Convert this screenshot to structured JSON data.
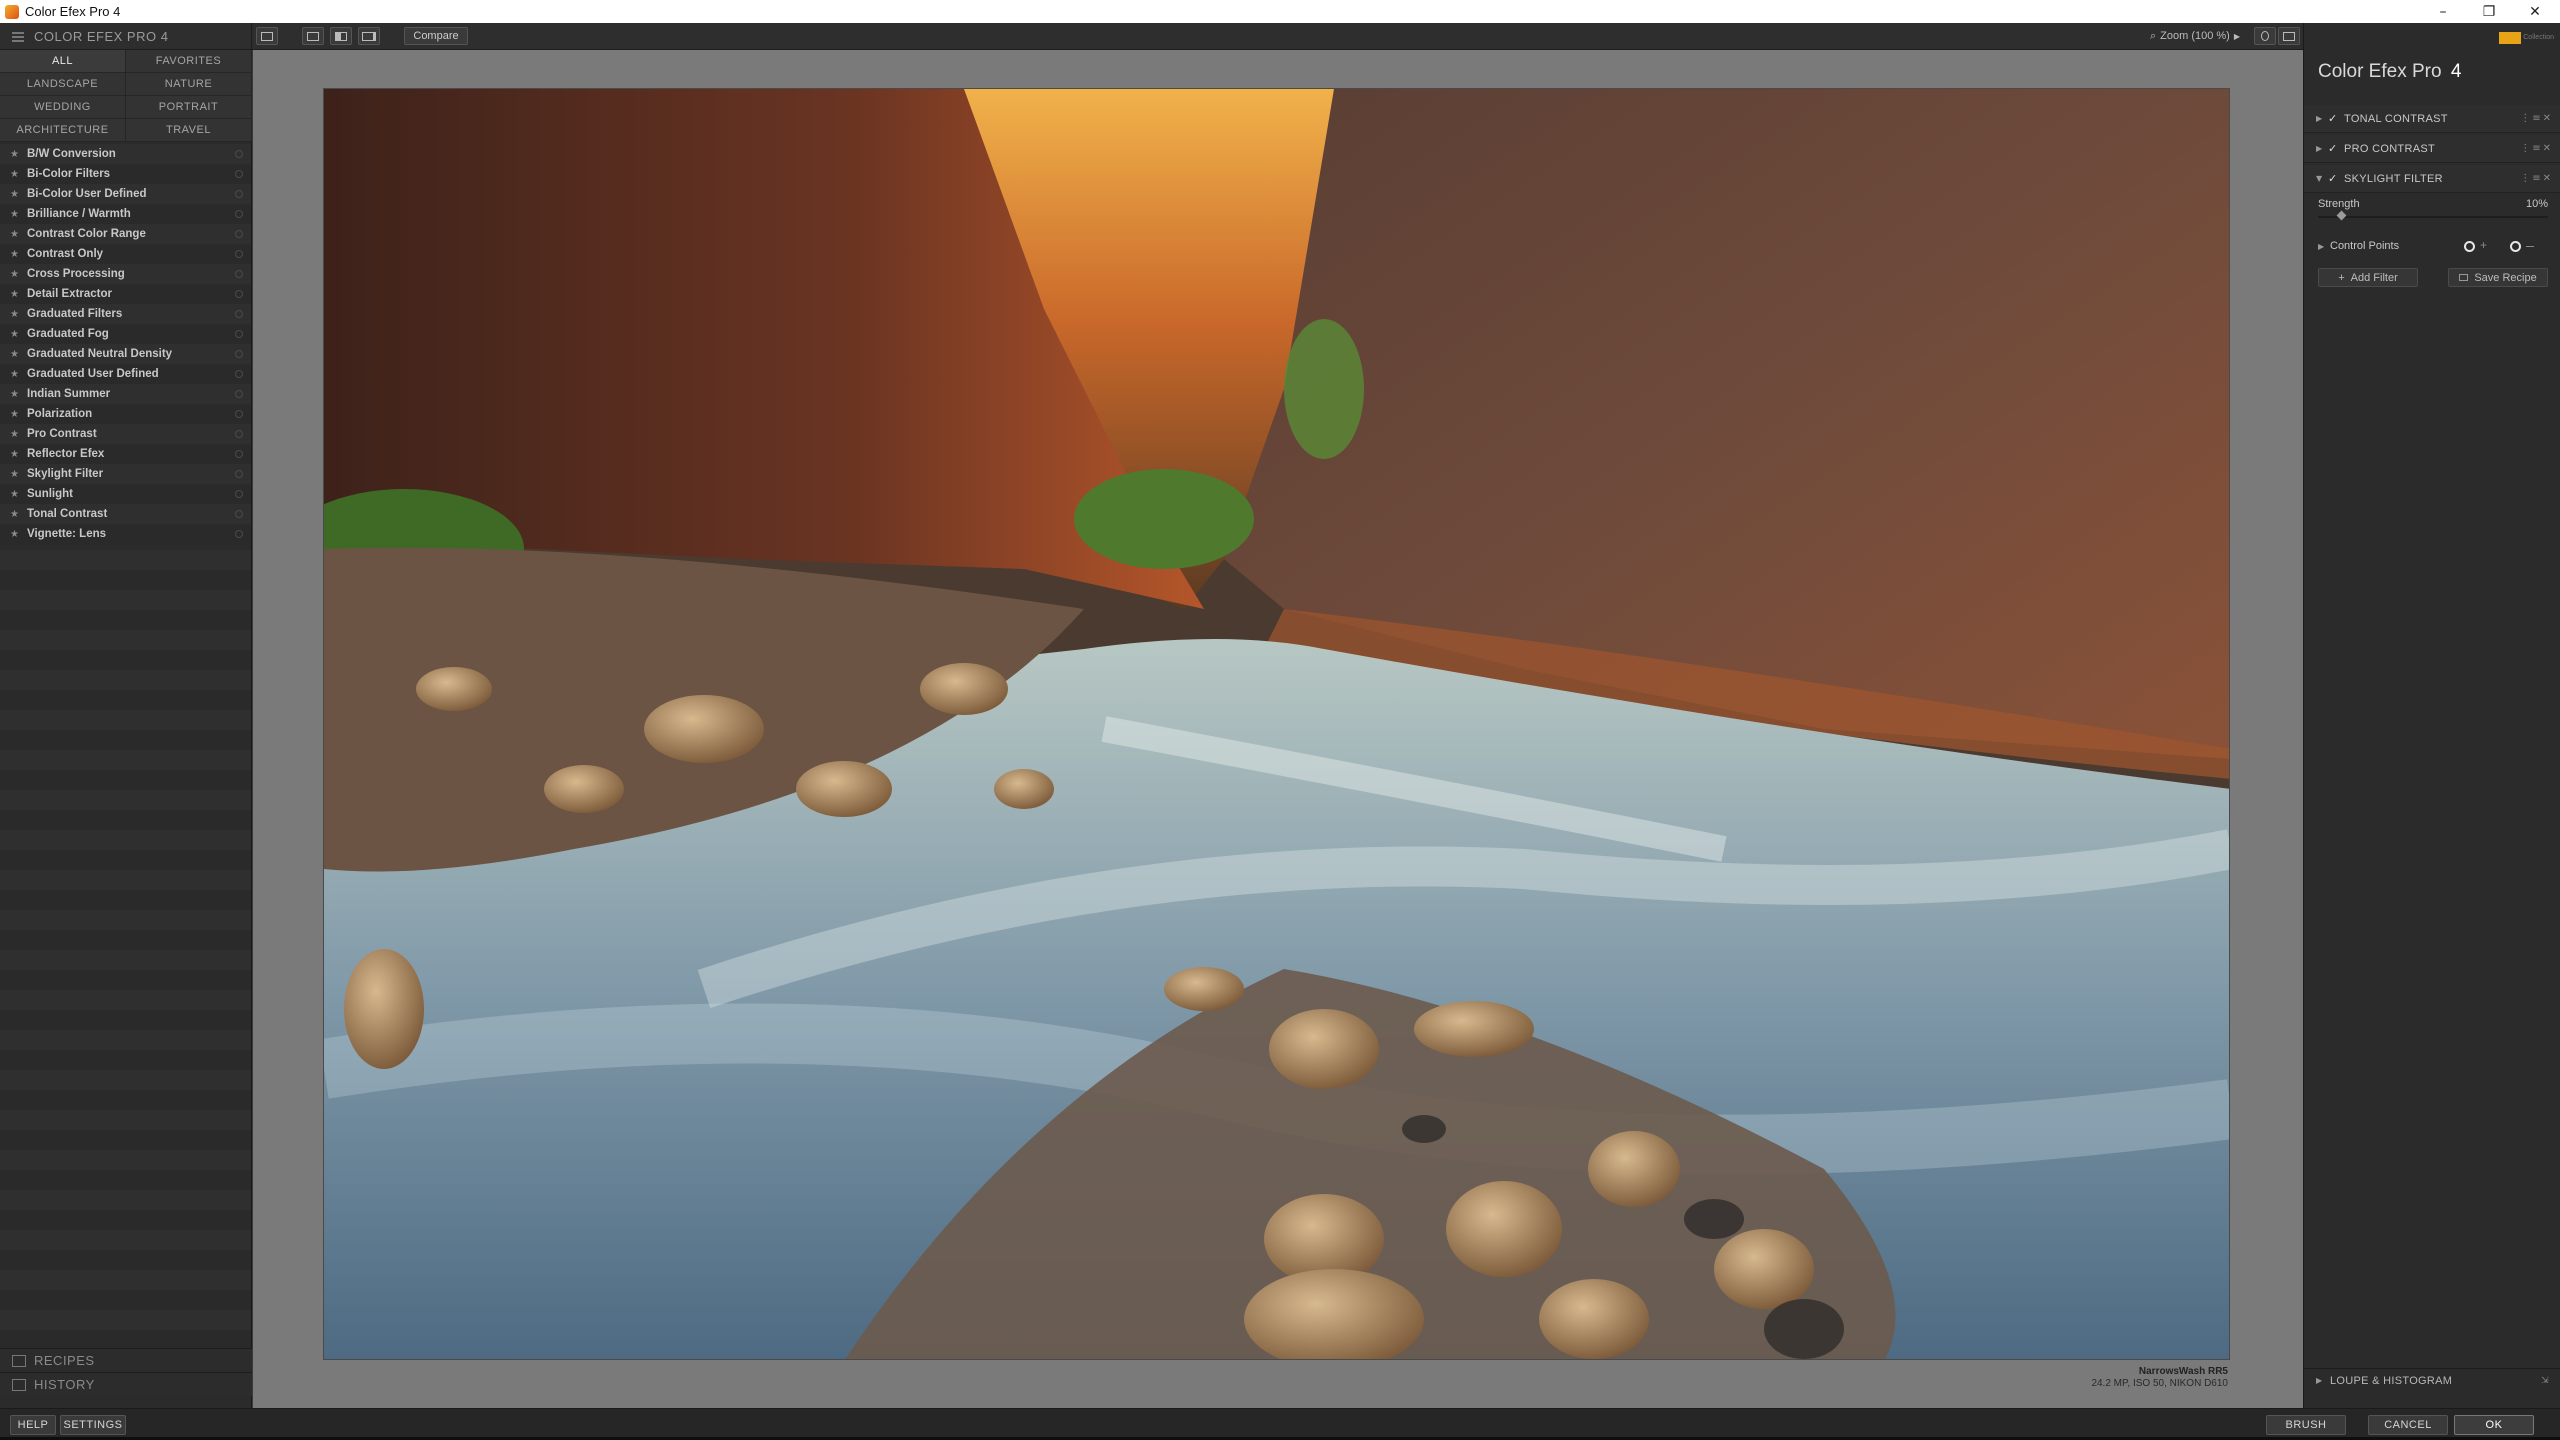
{
  "window": {
    "title": "Color Efex Pro 4",
    "controls": {
      "minimize": "–",
      "restore": "❐",
      "close": "✕"
    }
  },
  "toolbar": {
    "compare_label": "Compare",
    "zoom_label": "Zoom (100 %)"
  },
  "left_panel": {
    "title": "COLOR EFEX PRO 4",
    "categories": [
      {
        "label": "ALL",
        "active": true
      },
      {
        "label": "FAVORITES"
      },
      {
        "label": "LANDSCAPE"
      },
      {
        "label": "NATURE"
      },
      {
        "label": "WEDDING"
      },
      {
        "label": "PORTRAIT"
      },
      {
        "label": "ARCHITECTURE"
      },
      {
        "label": "TRAVEL"
      }
    ],
    "filters": [
      "B/W Conversion",
      "Bi-Color Filters",
      "Bi-Color User Defined",
      "Brilliance / Warmth",
      "Contrast Color Range",
      "Contrast Only",
      "Cross Processing",
      "Detail Extractor",
      "Graduated Filters",
      "Graduated Fog",
      "Graduated Neutral Density",
      "Graduated User Defined",
      "Indian Summer",
      "Polarization",
      "Pro Contrast",
      "Reflector Efex",
      "Skylight Filter",
      "Sunlight",
      "Tonal Contrast",
      "Vignette: Lens"
    ],
    "recipes_label": "RECIPES",
    "history_label": "HISTORY"
  },
  "photo": {
    "caption_title": "NarrowsWash RR5",
    "caption_meta": "24.2 MP, ISO 50, NIKON D610"
  },
  "right_panel": {
    "brand": "Collection",
    "product_title": "Color Efex Pro",
    "product_version": "4",
    "filter_stack": [
      {
        "name": "TONAL CONTRAST",
        "expanded": false,
        "checked": true
      },
      {
        "name": "PRO CONTRAST",
        "expanded": false,
        "checked": true
      },
      {
        "name": "SKYLIGHT FILTER",
        "expanded": true,
        "checked": true
      }
    ],
    "strength_label": "Strength",
    "strength_value": "10%",
    "strength_fraction": 0.1,
    "control_points_label": "Control Points",
    "add_filter_label": "Add Filter",
    "save_recipe_label": "Save Recipe",
    "loupe_label": "LOUPE & HISTOGRAM"
  },
  "bottom_bar": {
    "help_label": "HELP",
    "settings_label": "SETTINGS",
    "brush_label": "BRUSH",
    "cancel_label": "CANCEL",
    "ok_label": "OK"
  },
  "icons": {
    "star": "★",
    "check": "✓",
    "caret_right": "▶",
    "caret_down": "▼",
    "plus": "+",
    "pin": "⇲"
  }
}
